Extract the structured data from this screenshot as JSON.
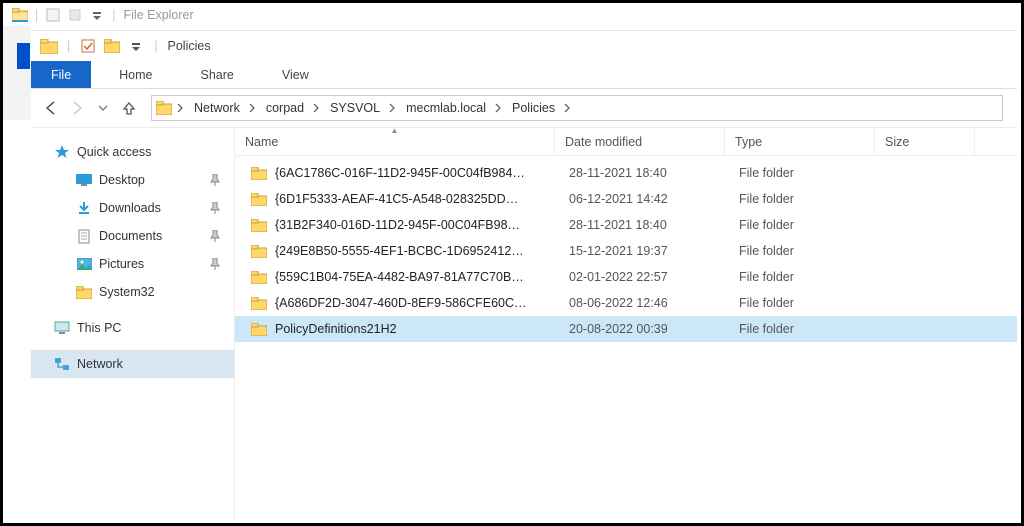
{
  "outer_title": "File Explorer",
  "inner_title": "Policies",
  "ribbon": {
    "file": "File",
    "home": "Home",
    "share": "Share",
    "view": "View"
  },
  "breadcrumbs": [
    "Network",
    "corpad",
    "SYSVOL",
    "mecmlab.local",
    "Policies"
  ],
  "columns": {
    "name": "Name",
    "date": "Date modified",
    "type": "Type",
    "size": "Size"
  },
  "sidebar": {
    "quick_access": "Quick access",
    "desktop": "Desktop",
    "downloads": "Downloads",
    "documents": "Documents",
    "pictures": "Pictures",
    "system32": "System32",
    "this_pc": "This PC",
    "network": "Network"
  },
  "rows": [
    {
      "name": "{6AC1786C-016F-11D2-945F-00C04fB984…",
      "date": "28-11-2021 18:40",
      "type": "File folder",
      "selected": false
    },
    {
      "name": "{6D1F5333-AEAF-41C5-A548-028325DD…",
      "date": "06-12-2021 14:42",
      "type": "File folder",
      "selected": false
    },
    {
      "name": "{31B2F340-016D-11D2-945F-00C04FB98…",
      "date": "28-11-2021 18:40",
      "type": "File folder",
      "selected": false
    },
    {
      "name": "{249E8B50-5555-4EF1-BCBC-1D6952412…",
      "date": "15-12-2021 19:37",
      "type": "File folder",
      "selected": false
    },
    {
      "name": "{559C1B04-75EA-4482-BA97-81A77C70B…",
      "date": "02-01-2022 22:57",
      "type": "File folder",
      "selected": false
    },
    {
      "name": "{A686DF2D-3047-460D-8EF9-586CFE60C…",
      "date": "08-06-2022 12:46",
      "type": "File folder",
      "selected": false
    },
    {
      "name": "PolicyDefinitions21H2",
      "date": "20-08-2022 00:39",
      "type": "File folder",
      "selected": true
    }
  ]
}
